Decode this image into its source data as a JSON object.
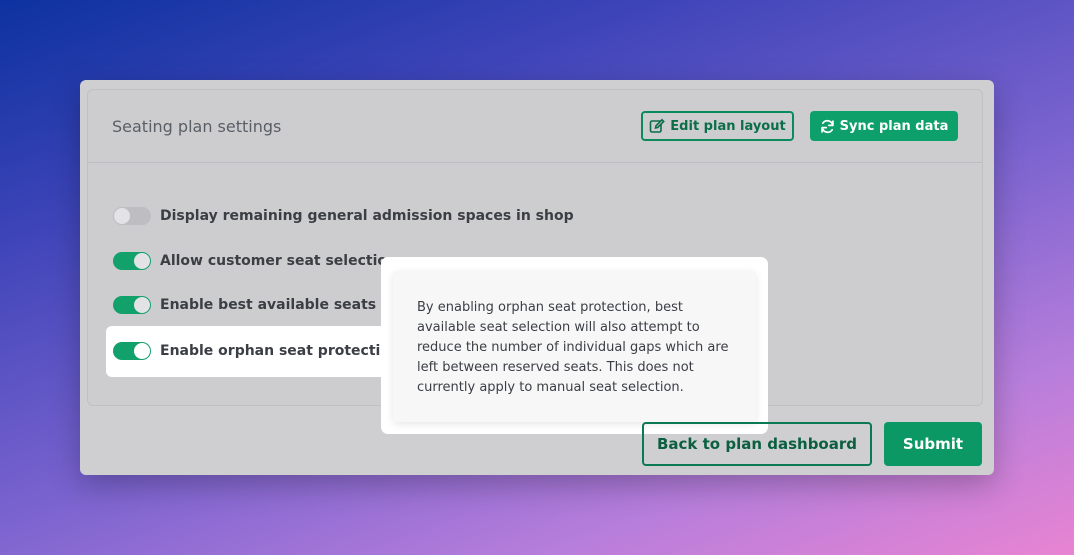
{
  "card": {
    "title": "Seating plan settings",
    "edit_button": {
      "label": "Edit plan layout",
      "icon": "edit-icon"
    },
    "sync_button": {
      "label": "Sync plan data",
      "icon": "sync-icon"
    }
  },
  "settings": [
    {
      "label": "Display remaining general admission spaces in shop",
      "enabled": false
    },
    {
      "label": "Allow customer seat selection",
      "enabled": true
    },
    {
      "label": "Enable best available seats",
      "enabled": true,
      "info_icon": "info-icon"
    },
    {
      "label": "Enable orphan seat protection",
      "enabled": true,
      "info_icon": "info-icon"
    }
  ],
  "tooltip": {
    "text": "By enabling orphan seat protection, best available seat selection will also attempt to reduce the number of individual gaps which are left between reserved seats. This does not currently apply to manual seat selection."
  },
  "footer": {
    "back_label": "Back to plan dashboard",
    "submit_label": "Submit"
  },
  "colors": {
    "accent": "#0ea06a",
    "toggle_off": "#bdbdc2"
  }
}
